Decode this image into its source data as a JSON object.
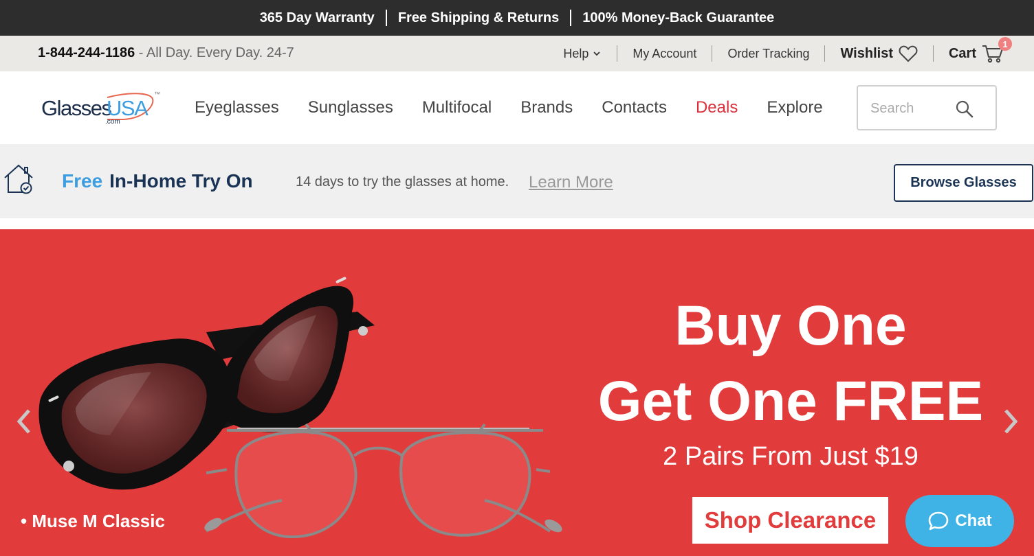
{
  "promo": {
    "items": [
      "365 Day Warranty",
      "Free Shipping & Returns",
      "100% Money-Back Guarantee"
    ]
  },
  "utility": {
    "phone": "1-844-244-1186",
    "hours": " - All Day. Every Day. 24-7",
    "help": "Help",
    "my_account": "My Account",
    "order_tracking": "Order Tracking",
    "wishlist": "Wishlist",
    "cart": "Cart",
    "cart_count": "1"
  },
  "logo": {
    "text_a": "Glasses",
    "text_b": "USA",
    "suffix": ".com",
    "tm": "™"
  },
  "nav": {
    "items": [
      "Eyeglasses",
      "Sunglasses",
      "Multifocal",
      "Brands",
      "Contacts",
      "Deals",
      "Explore"
    ]
  },
  "search": {
    "placeholder": "Search"
  },
  "tryon": {
    "free": "Free",
    "title": "In-Home Try On",
    "desc": "14 days to try the glasses at home.",
    "learn_more": "Learn More",
    "browse": "Browse Glasses"
  },
  "hero": {
    "line1": "Buy One",
    "line2": "Get One FREE",
    "sub": "2 Pairs From Just $19",
    "cta": "Shop Clearance",
    "caption": "• Muse M Classic"
  },
  "chat": {
    "label": "Chat"
  },
  "colors": {
    "promo_bg": "#2d2d2d",
    "hero_bg": "#e23b3c",
    "deals": "#d9303b",
    "navy": "#1a3355",
    "accent_blue": "#3c9ee0",
    "chat_bg": "#3fb3e6"
  }
}
